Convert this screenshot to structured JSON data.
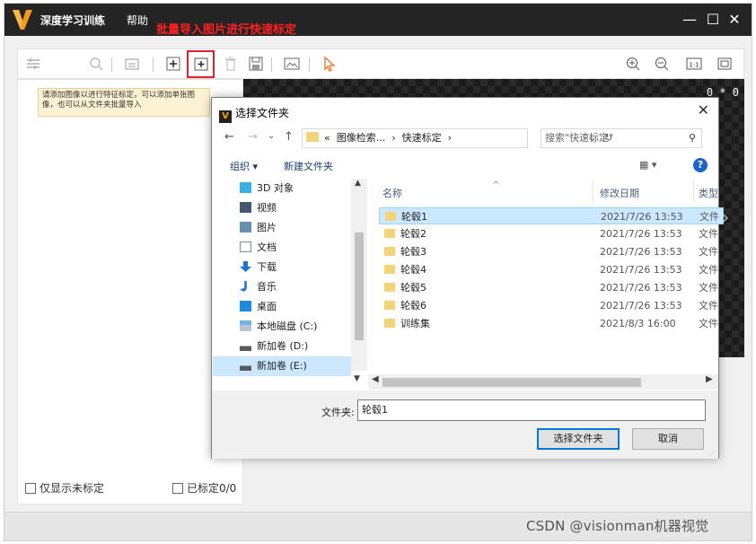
{
  "app": {
    "title": "深度学习训练",
    "menu_help": "帮助",
    "annotation": "批量导入图片进行快速标定",
    "win_min": "—",
    "win_max": "☐",
    "win_close": "✕",
    "coord": "0 * 0"
  },
  "left_panel": {
    "tooltip": "请添加图像以进行特征标定，可以添加单张图像，也可以从文件夹批量导入",
    "show_unlabeled": "仅显示未标定",
    "labeled_count": "已标定0/0"
  },
  "dialog": {
    "title": "选择文件夹",
    "close": "✕",
    "nav_back": "←",
    "nav_forward": "→",
    "nav_dropdown": "⌄",
    "nav_up": "↑",
    "address_prefix": "«",
    "address_parts": [
      "图像检索...",
      "›",
      "快速标定",
      "›"
    ],
    "search_placeholder": "搜索\"快速标定\"",
    "organize": "组织 ▾",
    "new_folder": "新建文件夹",
    "view_toggle": "▦ ▾",
    "help": "?",
    "nav_items": [
      {
        "label": "3D 对象",
        "icon": "cube-icon"
      },
      {
        "label": "视频",
        "icon": "video-icon"
      },
      {
        "label": "图片",
        "icon": "picture-icon"
      },
      {
        "label": "文档",
        "icon": "document-icon"
      },
      {
        "label": "下载",
        "icon": "download-icon"
      },
      {
        "label": "音乐",
        "icon": "music-icon"
      },
      {
        "label": "桌面",
        "icon": "desktop-icon"
      },
      {
        "label": "本地磁盘 (C:)",
        "icon": "disk-icon"
      },
      {
        "label": "新加卷 (D:)",
        "icon": "drive-icon"
      },
      {
        "label": "新加卷 (E:)",
        "icon": "drive-icon"
      }
    ],
    "columns": {
      "name": "名称",
      "date": "修改日期",
      "type": "类型"
    },
    "files": [
      {
        "name": "轮毂1",
        "date": "2021/7/26 13:53",
        "type": "文件"
      },
      {
        "name": "轮毂2",
        "date": "2021/7/26 13:53",
        "type": "文件"
      },
      {
        "name": "轮毂3",
        "date": "2021/7/26 13:53",
        "type": "文件"
      },
      {
        "name": "轮毂4",
        "date": "2021/7/26 13:53",
        "type": "文件"
      },
      {
        "name": "轮毂5",
        "date": "2021/7/26 13:53",
        "type": "文件"
      },
      {
        "name": "轮毂6",
        "date": "2021/7/26 13:53",
        "type": "文件"
      },
      {
        "name": "训练集",
        "date": "2021/8/3 16:00",
        "type": "文件"
      }
    ],
    "folder_label": "文件夹:",
    "folder_value": "轮毂1",
    "ok": "选择文件夹",
    "cancel": "取消"
  },
  "watermark": "CSDN @visionman机器视觉"
}
